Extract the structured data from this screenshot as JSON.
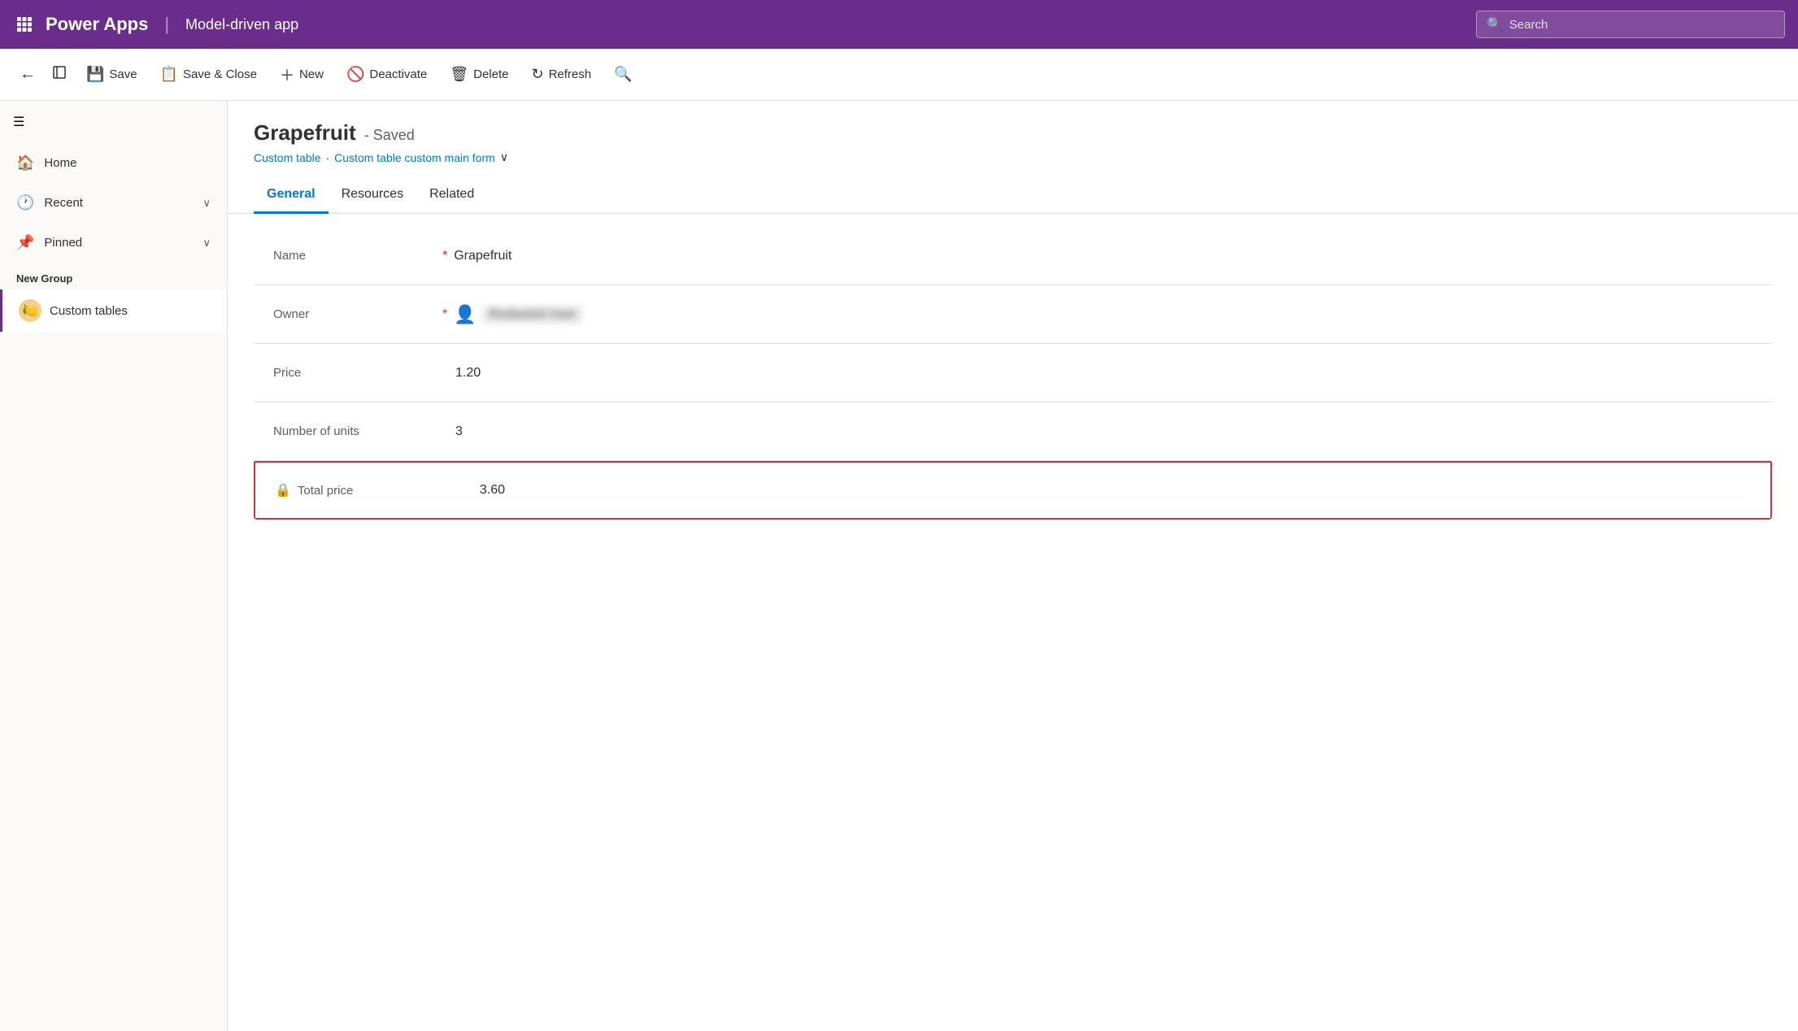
{
  "header": {
    "app_name": "Power Apps",
    "divider": "|",
    "app_subtitle": "Model-driven app",
    "search_placeholder": "Search"
  },
  "toolbar": {
    "back_label": "←",
    "expand_label": "⊡",
    "save_label": "Save",
    "save_close_label": "Save & Close",
    "new_label": "New",
    "deactivate_label": "Deactivate",
    "delete_label": "Delete",
    "refresh_label": "Refresh",
    "search_label": "🔍"
  },
  "sidebar": {
    "menu_icon": "☰",
    "nav_items": [
      {
        "id": "home",
        "icon": "🏠",
        "label": "Home",
        "has_chevron": false
      },
      {
        "id": "recent",
        "icon": "🕐",
        "label": "Recent",
        "has_chevron": true
      },
      {
        "id": "pinned",
        "icon": "📌",
        "label": "Pinned",
        "has_chevron": true
      }
    ],
    "group_label": "New Group",
    "custom_item": {
      "icon": "🍋",
      "label": "Custom tables"
    }
  },
  "record": {
    "title": "Grapefruit",
    "status": "- Saved",
    "breadcrumb_table": "Custom table",
    "breadcrumb_separator": "·",
    "breadcrumb_form": "Custom table custom main form",
    "tabs": [
      {
        "id": "general",
        "label": "General",
        "active": true
      },
      {
        "id": "resources",
        "label": "Resources",
        "active": false
      },
      {
        "id": "related",
        "label": "Related",
        "active": false
      }
    ],
    "fields": [
      {
        "id": "name",
        "label": "Name",
        "required": true,
        "value": "Grapefruit",
        "type": "text",
        "locked": false
      },
      {
        "id": "owner",
        "label": "Owner",
        "required": true,
        "value": "██████████",
        "type": "owner",
        "locked": false
      },
      {
        "id": "price",
        "label": "Price",
        "required": false,
        "value": "1.20",
        "type": "text",
        "locked": false
      },
      {
        "id": "number_of_units",
        "label": "Number of units",
        "required": false,
        "value": "3",
        "type": "text",
        "locked": false
      },
      {
        "id": "total_price",
        "label": "Total price",
        "required": false,
        "value": "3.60",
        "type": "text",
        "locked": true,
        "highlighted": true
      }
    ]
  }
}
